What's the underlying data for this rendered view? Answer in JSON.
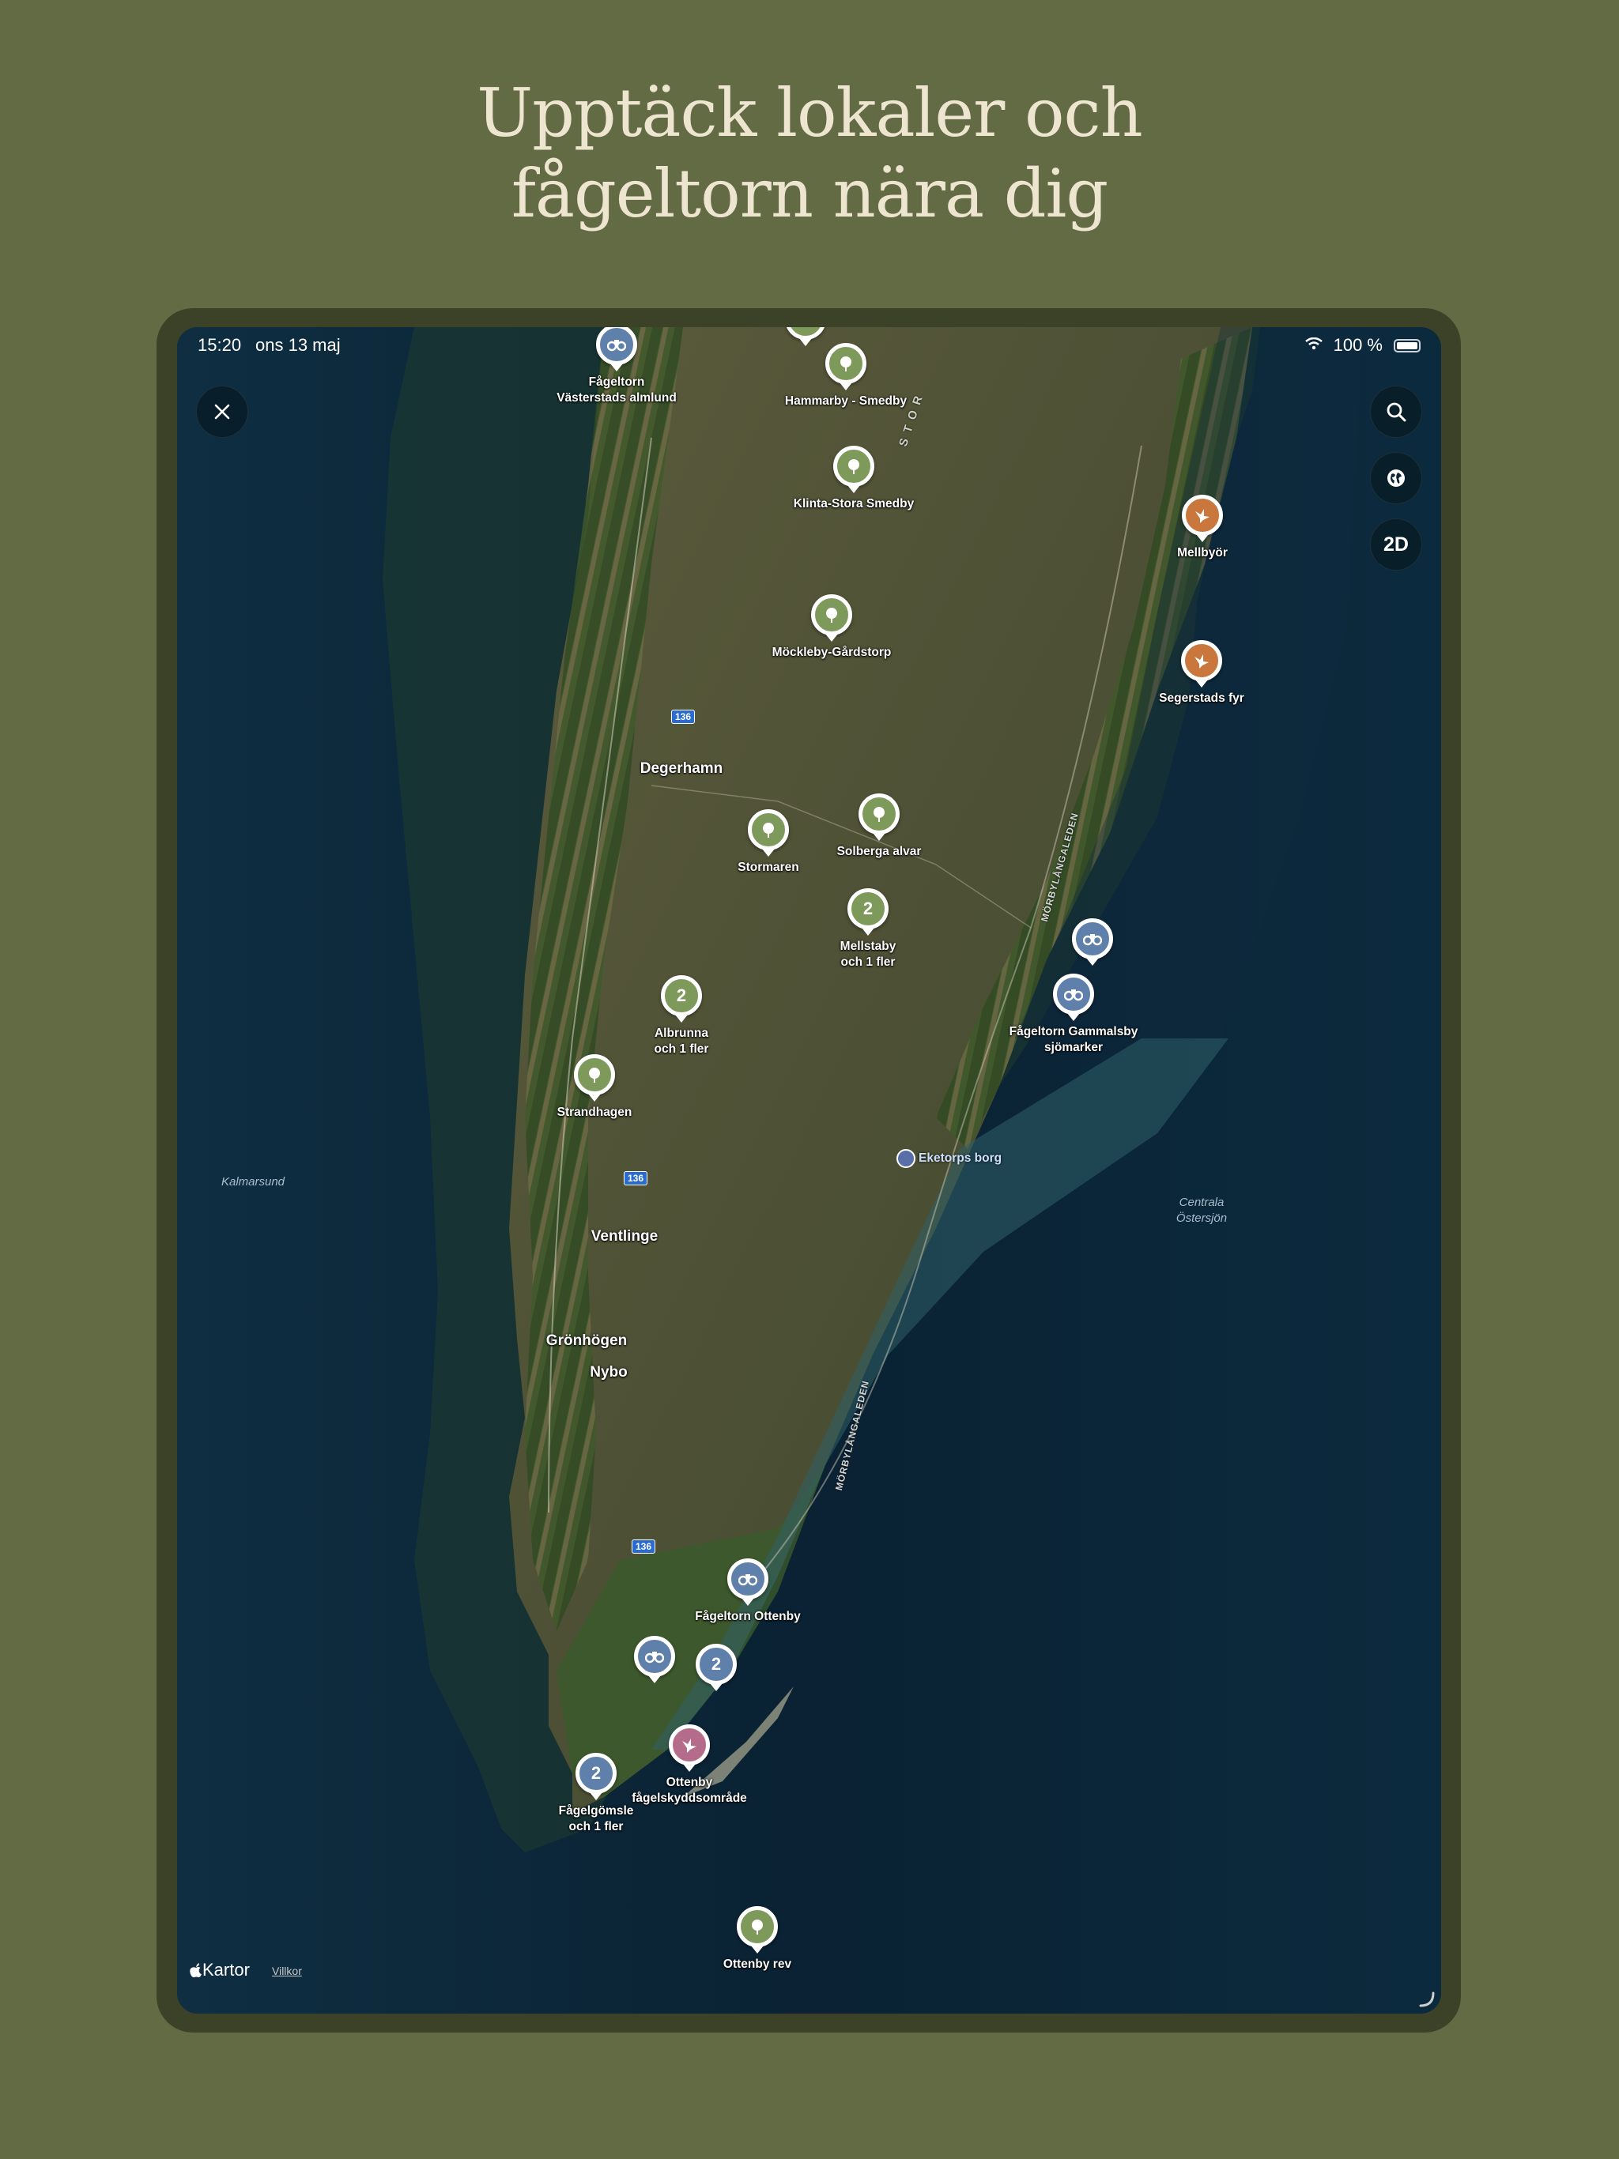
{
  "headline": {
    "line1": "Upptäck lokaler och",
    "line2": "fågeltorn nära dig"
  },
  "status_bar": {
    "time": "15:20",
    "date": "ons 13 maj",
    "battery": "100 %"
  },
  "controls": {
    "mode_toggle": "2D"
  },
  "pins": [
    {
      "label": "Fågeltorn\nVästerstads almlund",
      "type": "birdtower",
      "color": "#5f80ab"
    },
    {
      "label": "",
      "type": "nature",
      "color": "#7d9a5a"
    },
    {
      "label": "Hammarby - Smedby",
      "type": "nature",
      "color": "#7d9a5a"
    },
    {
      "label": "Klinta-Stora Smedby",
      "type": "nature",
      "color": "#7d9a5a"
    },
    {
      "label": "Mellbyör",
      "type": "bird",
      "color": "#c9773c"
    },
    {
      "label": "Möckleby-Gårdstorp",
      "type": "nature",
      "color": "#7d9a5a"
    },
    {
      "label": "Segerstads fyr",
      "type": "bird",
      "color": "#c9773c"
    },
    {
      "label": "Stormaren",
      "type": "nature",
      "color": "#7d9a5a"
    },
    {
      "label": "Solberga alvar",
      "type": "nature",
      "color": "#7d9a5a"
    },
    {
      "label": "Mellstaby\noch 1 fler",
      "type": "cluster",
      "count": "2",
      "color": "#7d9a5a"
    },
    {
      "label": "",
      "type": "birdtower",
      "color": "#5f80ab"
    },
    {
      "label": "Fågeltorn Gammalsby\nsjömarker",
      "type": "birdtower",
      "color": "#5f80ab"
    },
    {
      "label": "Albrunna\noch 1 fler",
      "type": "cluster",
      "count": "2",
      "color": "#7d9a5a"
    },
    {
      "label": "Strandhagen",
      "type": "nature",
      "color": "#7d9a5a"
    },
    {
      "label": "Fågeltorn Ottenby",
      "type": "birdtower",
      "color": "#5f80ab"
    },
    {
      "label": "",
      "type": "birdtower",
      "color": "#5f80ab"
    },
    {
      "label": "",
      "type": "cluster",
      "count": "2",
      "color": "#5f80ab"
    },
    {
      "label": "Ottenby\nfågelskyddsområde",
      "type": "bird",
      "color": "#b56b8a"
    },
    {
      "label": "Fågelgömsle\noch 1 fler",
      "type": "cluster",
      "count": "2",
      "color": "#5f80ab"
    },
    {
      "label": "Ottenby rev",
      "type": "nature",
      "color": "#7d9a5a"
    }
  ],
  "places": [
    "Degerhamn",
    "Ventlinge",
    "Grönhögen",
    "Nybo"
  ],
  "water_labels": [
    "Kalmarsund",
    "Centrala\nÖstersjön"
  ],
  "road_labels": [
    "MÖRBYLÅNGALEDEN",
    "MÖRBYLÅNGALEDEN"
  ],
  "road_shields": [
    "136",
    "136",
    "136"
  ],
  "terrain_label": "S T O R",
  "poi": {
    "label": "Eketorps borg"
  },
  "footer": {
    "brand": "Kartor",
    "terms": "Villkor"
  }
}
